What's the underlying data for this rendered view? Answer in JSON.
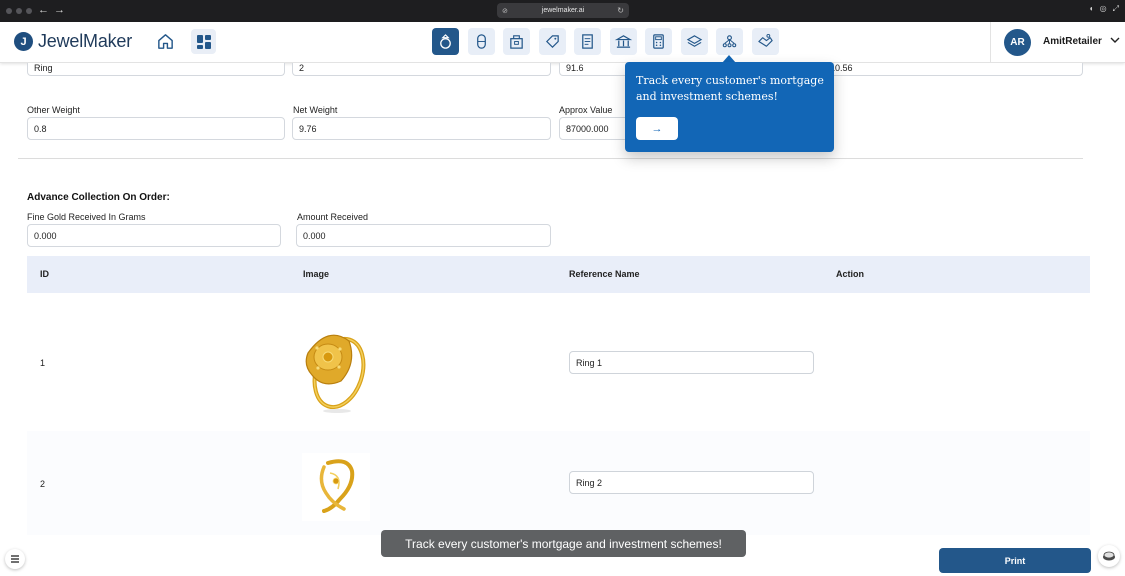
{
  "browser": {
    "url": "jewelmaker.ai"
  },
  "header": {
    "brand": "JewelMaker",
    "user": {
      "initials": "AR",
      "name": "AmitRetailer"
    },
    "nav_icons": [
      "ring-icon",
      "bracelet-icon",
      "box-icon",
      "tag-icon",
      "ledger-icon",
      "bank-icon",
      "calculator-icon",
      "layers-icon",
      "network-icon",
      "handshake-icon"
    ],
    "accent": "#23578a"
  },
  "top_row": {
    "item": "Ring",
    "qty": "2",
    "purity": "91.6",
    "gross": "10.56"
  },
  "weights": {
    "other_weight_label": "Other Weight",
    "other_weight": "0.8",
    "net_weight_label": "Net Weight",
    "net_weight": "9.76",
    "approx_value_label": "Approx Value",
    "approx_value": "87000.000"
  },
  "advance": {
    "title": "Advance Collection On Order:",
    "fine_gold_label": "Fine Gold Received In Grams",
    "fine_gold": "0.000",
    "amount_label": "Amount Received",
    "amount": "0.000"
  },
  "table": {
    "columns": [
      "ID",
      "Image",
      "Reference Name",
      "Action"
    ],
    "rows": [
      {
        "id": "1",
        "reference": "Ring 1"
      },
      {
        "id": "2",
        "reference": "Ring 2"
      }
    ]
  },
  "tooltip": {
    "text": "Track every customer's mortgage and investment schemes!",
    "button": "→",
    "color": "#1266b6"
  },
  "toast": "Track every customer's mortgage and investment schemes!",
  "actions": {
    "print": "Print"
  }
}
